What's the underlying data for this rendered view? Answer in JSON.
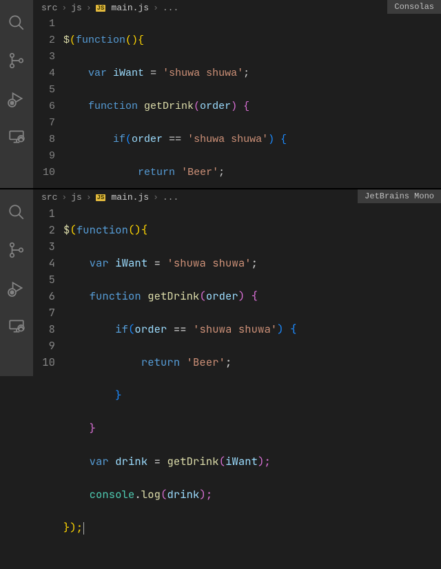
{
  "fontLabels": {
    "top": "Consolas",
    "bottom": "JetBrains Mono"
  },
  "breadcrumbs": {
    "seg1": "src",
    "seg2": "js",
    "badge": "JS",
    "file": "main.js",
    "tail": "..."
  },
  "lineNumbers": [
    "1",
    "2",
    "3",
    "4",
    "5",
    "6",
    "7",
    "8",
    "9",
    "10"
  ],
  "code": {
    "l1": {
      "a": "$",
      "b": "(",
      "c": "function",
      "d": "(){"
    },
    "l2": {
      "a": "var",
      "b": "iWant",
      "c": "=",
      "d": "'shuwa shuwa'",
      "e": ";"
    },
    "l3": {
      "a": "function",
      "b": "getDrink",
      "c": "(",
      "d": "order",
      "e": ") {"
    },
    "l4": {
      "a": "if",
      "b": "(",
      "c": "order",
      "d": "==",
      "e": "'shuwa shuwa'",
      "f": ") {"
    },
    "l5": {
      "a": "return",
      "b": "'Beer'",
      "c": ";"
    },
    "l6": {
      "a": "}"
    },
    "l7": {
      "a": "}"
    },
    "l8": {
      "a": "var",
      "b": "drink",
      "c": "=",
      "d": "getDrink",
      "e": "(",
      "f": "iWant",
      "g": ");"
    },
    "l9": {
      "a": "console",
      "b": ".",
      "c": "log",
      "d": "(",
      "e": "drink",
      "f": ");"
    },
    "l10": {
      "a": "});"
    }
  }
}
